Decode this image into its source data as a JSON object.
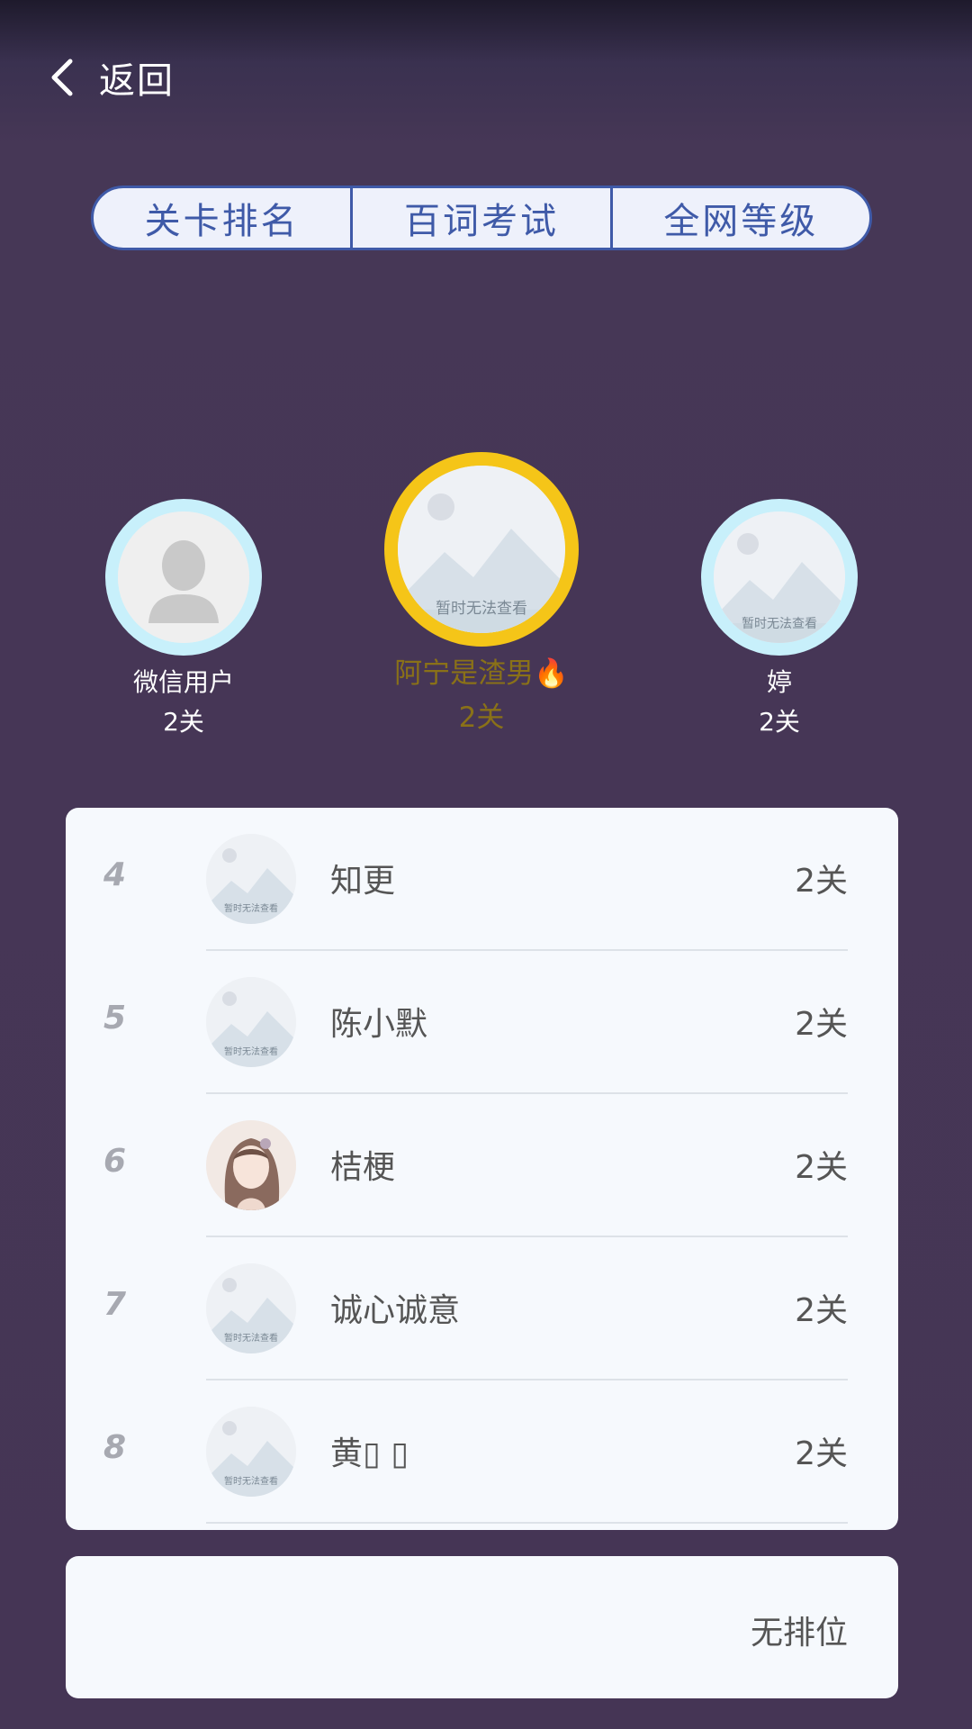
{
  "header": {
    "back_label": "返回"
  },
  "tabs": [
    {
      "label": "关卡排名"
    },
    {
      "label": "百词考试"
    },
    {
      "label": "全网等级"
    }
  ],
  "podium": {
    "first": {
      "name": "阿宁是渣男🔥",
      "score": "2关",
      "avatar_text": "暂时无法查看"
    },
    "second": {
      "name": "微信用户",
      "score": "2关"
    },
    "third": {
      "name": "婷",
      "score": "2关",
      "avatar_text": "暂时无法查看"
    }
  },
  "ranking": [
    {
      "rank": "4",
      "name": "知更",
      "score": "2关",
      "avatar_text": "暂时无法查看"
    },
    {
      "rank": "5",
      "name": "陈小默",
      "score": "2关",
      "avatar_text": "暂时无法查看"
    },
    {
      "rank": "6",
      "name": "桔梗",
      "score": "2关"
    },
    {
      "rank": "7",
      "name": "诚心诚意",
      "score": "2关",
      "avatar_text": "暂时无法查看"
    },
    {
      "rank": "8",
      "name": "黄▯ ▯",
      "score": "2关",
      "avatar_text": "暂时无法查看"
    }
  ],
  "self": {
    "status": "无排位"
  },
  "colors": {
    "background": "#453555",
    "tab_accent": "#3f5aa8",
    "gold_ring": "#f5c518",
    "silver_ring": "#c8f0fb",
    "gold_text": "#8a7118"
  }
}
